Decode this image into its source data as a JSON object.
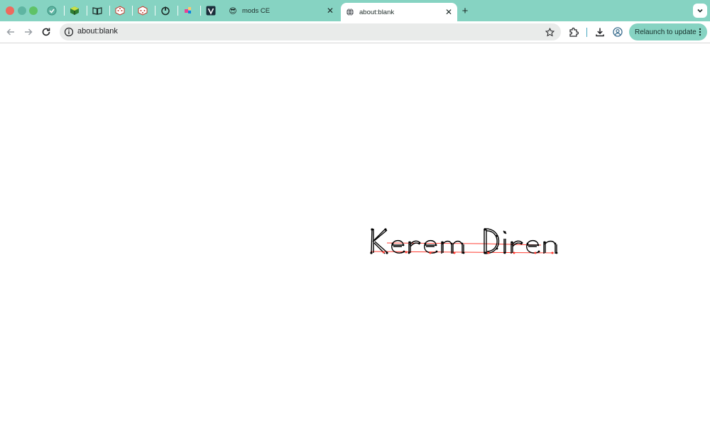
{
  "tabs": {
    "pinned": [
      {
        "icon": "shield-icon"
      },
      {
        "icon": "cube-icon"
      },
      {
        "icon": "book-icon"
      },
      {
        "icon": "dice-icon"
      },
      {
        "icon": "dice-icon"
      },
      {
        "icon": "power-icon"
      },
      {
        "icon": "puzzle-icon"
      },
      {
        "icon": "vimeo-icon"
      }
    ],
    "mods_tab": {
      "title": "mods CE",
      "icon": "😎"
    },
    "active_tab": {
      "title": "about:blank",
      "icon": "globe-icon"
    },
    "new_tab_label": "+"
  },
  "toolbar": {
    "url": "about:blank",
    "relaunch_label": "Relaunch to update",
    "accent_color": "#86d3c2"
  },
  "canvas": {
    "drawn_text": "Kerem Diren",
    "stroke_color": "#000000",
    "guide_color": "#ff0000"
  }
}
